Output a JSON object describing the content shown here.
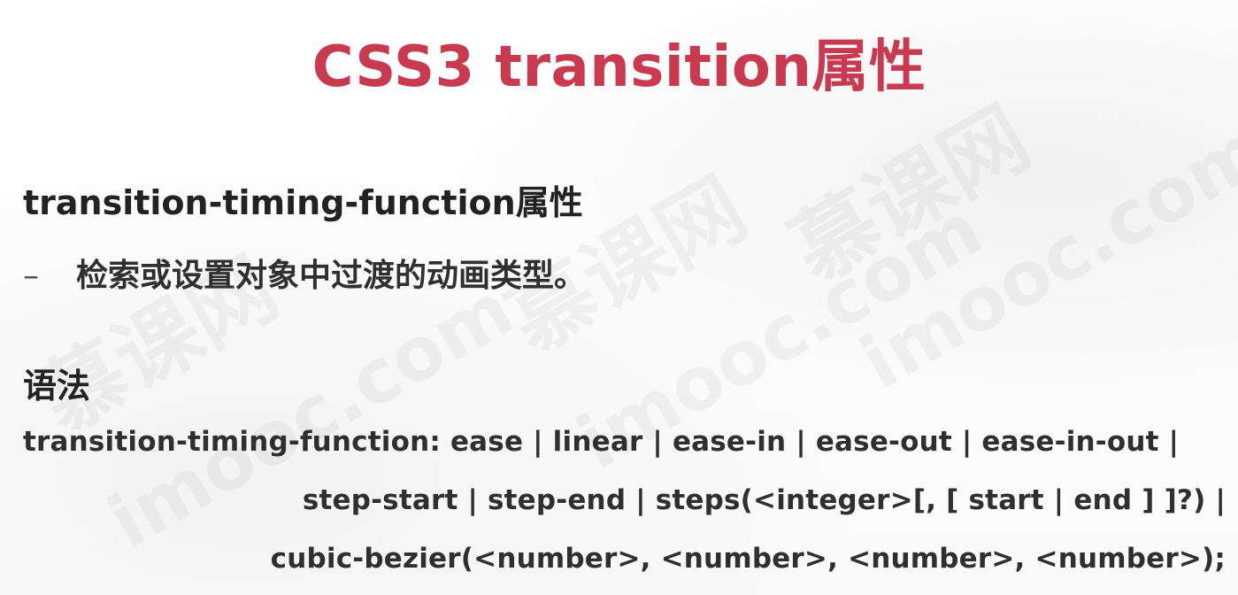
{
  "slide": {
    "title_en": "CSS3 transition",
    "title_cn": "属性",
    "property": {
      "name": "transition-timing-function属性",
      "bullet_marker": "–",
      "description": "检索或设置对象中过渡的动画类型。"
    },
    "syntax": {
      "heading": "语法",
      "lines": [
        "transition-timing-function: ease | linear | ease-in | ease-out | ease-in-out |",
        "step-start | step-end | steps(<integer>[, [ start | end ] ]?) |",
        "cubic-bezier(<number>, <number>, <number>, <number>);"
      ]
    },
    "watermark": {
      "cn": "慕课网",
      "en": "imooc.com"
    }
  },
  "colors": {
    "title": "#c83a50",
    "text": "#2f2f2f",
    "heading": "#222222"
  }
}
